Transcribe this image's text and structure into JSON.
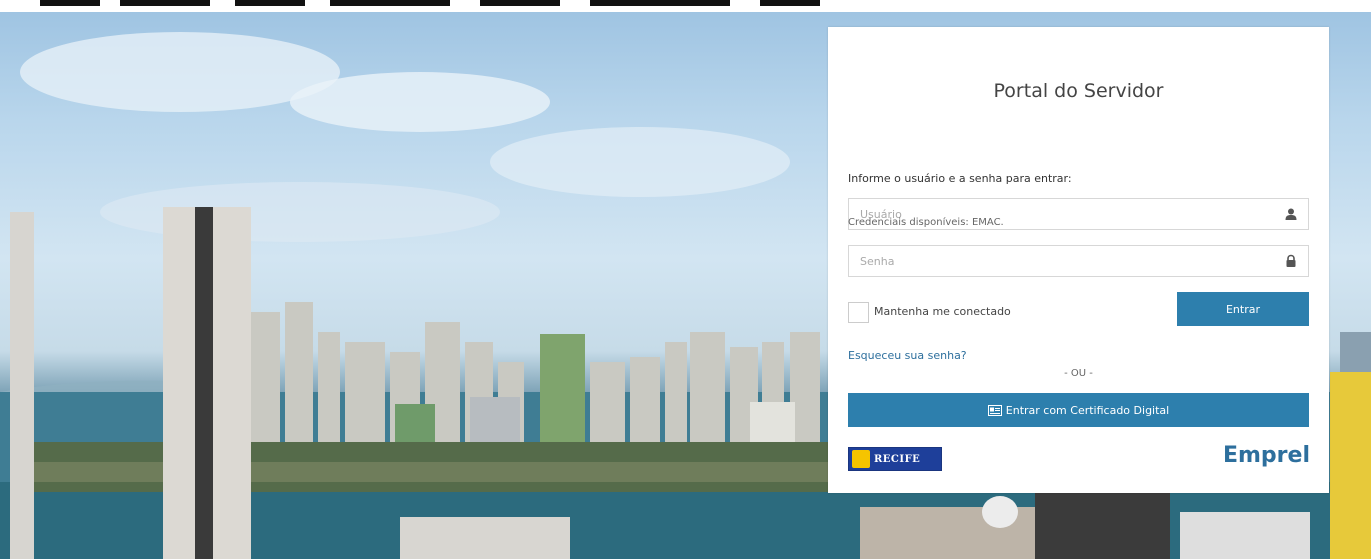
{
  "login": {
    "title": "Portal do Servidor",
    "prompt": "Informe o usuário e a senha para entrar:",
    "username_placeholder": "Usuário",
    "credentials_note": "Credenciais disponíveis: EMAC.",
    "password_placeholder": "Senha",
    "remember_label": "Mantenha me conectado",
    "remember_checked": false,
    "submit_label": "Entrar",
    "forgot_label": "Esqueceu sua senha?",
    "or_label": "- OU -",
    "certificate_label": "Entrar com Certificado Digital"
  },
  "logos": {
    "recife": "RECIFE",
    "emprel": "Emprel"
  },
  "icons": {
    "username": "user-icon",
    "password": "lock-icon",
    "certificate": "certificate-icon"
  },
  "colors": {
    "primary_button": "#2d7fad",
    "link": "#2d6f9d",
    "recife_blue": "#1e3f9a"
  }
}
